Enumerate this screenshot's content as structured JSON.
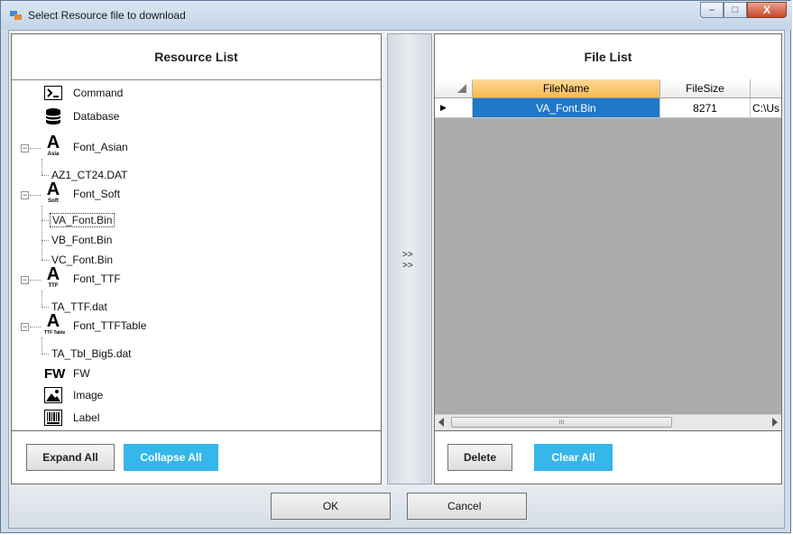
{
  "window": {
    "title": "Select Resource file to download",
    "controls": {
      "minimize": "–",
      "maximize": "□",
      "close": "X"
    }
  },
  "resource_panel": {
    "title": "Resource List",
    "tree": [
      {
        "label": "Command",
        "icon": "command-prompt-icon"
      },
      {
        "label": "Database",
        "icon": "database-icon"
      },
      {
        "label": "Font_Asian",
        "icon": "font-asian-icon",
        "icon_caption": "Asia",
        "expanded": true,
        "children": [
          {
            "label": "AZ1_CT24.DAT"
          }
        ]
      },
      {
        "label": "Font_Soft",
        "icon": "font-soft-icon",
        "icon_caption": "Soft",
        "expanded": true,
        "children": [
          {
            "label": "VA_Font.Bin",
            "selected": true
          },
          {
            "label": "VB_Font.Bin"
          },
          {
            "label": "VC_Font.Bin"
          }
        ]
      },
      {
        "label": "Font_TTF",
        "icon": "font-ttf-icon",
        "icon_caption": "TTF",
        "expanded": true,
        "children": [
          {
            "label": "TA_TTF.dat"
          }
        ]
      },
      {
        "label": "Font_TTFTable",
        "icon": "font-ttftable-icon",
        "icon_caption": "TTF Table",
        "expanded": true,
        "children": [
          {
            "label": "TA_Tbl_Big5.dat"
          }
        ]
      },
      {
        "label": "FW",
        "icon": "fw-icon",
        "icon_caption": "FW"
      },
      {
        "label": "Image",
        "icon": "image-icon"
      },
      {
        "label": "Label",
        "icon": "barcode-label-icon"
      }
    ],
    "buttons": {
      "expand_all": "Expand All",
      "collapse_all": "Collapse All"
    }
  },
  "transfer": {
    "arrow_top": ">>",
    "arrow_bottom": ">>"
  },
  "file_panel": {
    "title": "File List",
    "columns": [
      "FileName",
      "FileSize",
      ""
    ],
    "rows": [
      {
        "indicator": "▶",
        "filename": "VA_Font.Bin",
        "filesize": "8271",
        "path": "C:\\Us"
      }
    ],
    "scroll_grip": "III",
    "buttons": {
      "delete": "Delete",
      "clear_all": "Clear All"
    }
  },
  "dialog_buttons": {
    "ok": "OK",
    "cancel": "Cancel"
  },
  "colors": {
    "accent": "#35b7ea",
    "selection": "#1f78c8",
    "sorted_header": "#f7b94f"
  }
}
